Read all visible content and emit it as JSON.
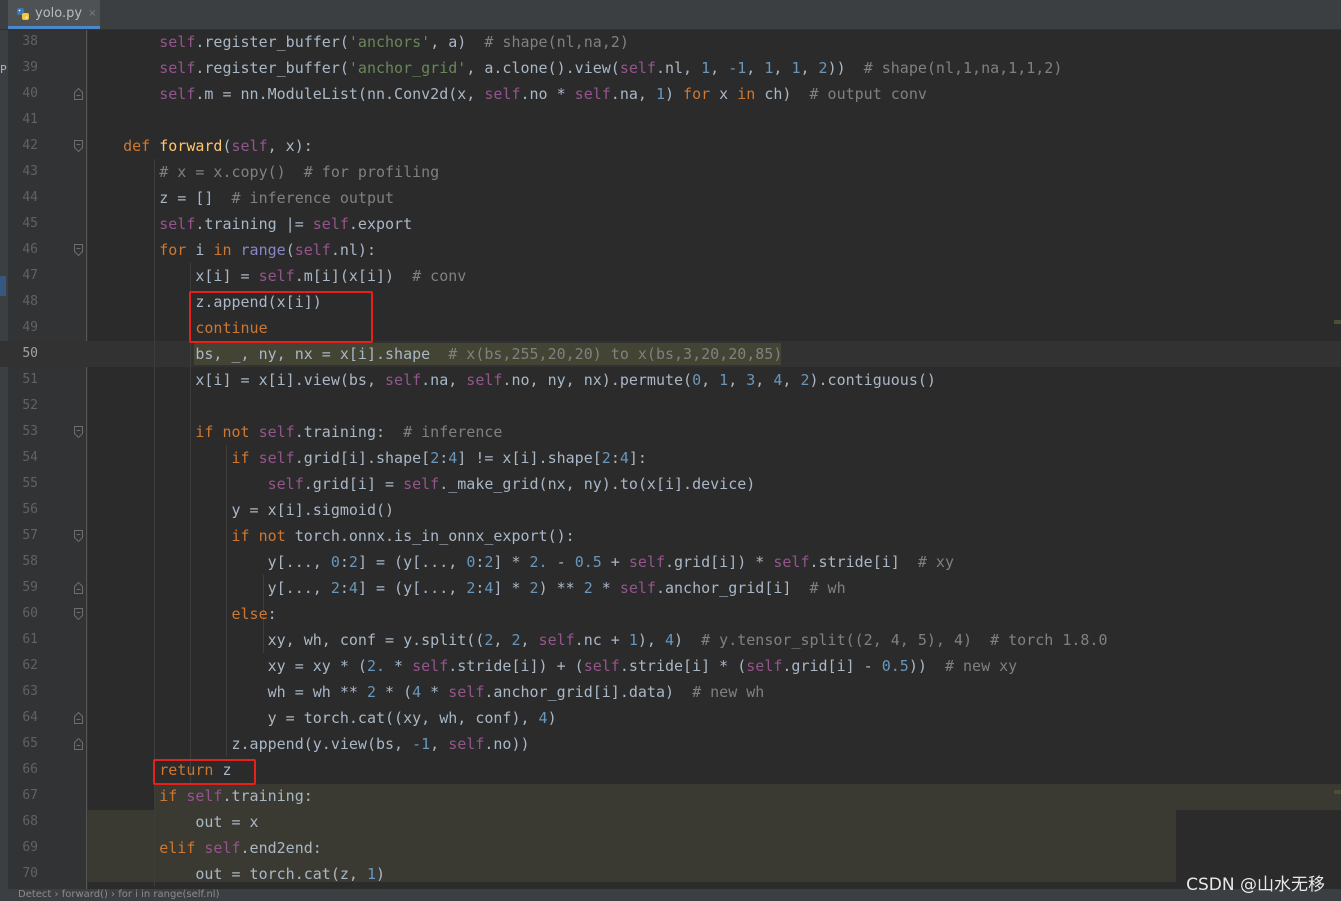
{
  "tab": {
    "file_name": "yolo.py",
    "close": "×"
  },
  "left_strip": {
    "glyph": "P"
  },
  "lines": [
    {
      "n": "38",
      "fold": "",
      "tokens": [
        [
          "pa",
          "        "
        ],
        [
          "sf",
          "self"
        ],
        [
          "pa",
          ".register_buffer("
        ],
        [
          "st",
          "'anchors'"
        ],
        [
          "pa",
          ", a)  "
        ],
        [
          "cm",
          "# shape(nl,na,2)"
        ]
      ]
    },
    {
      "n": "39",
      "fold": "",
      "tokens": [
        [
          "pa",
          "        "
        ],
        [
          "sf",
          "self"
        ],
        [
          "pa",
          ".register_buffer("
        ],
        [
          "st",
          "'anchor_grid'"
        ],
        [
          "pa",
          ", a.clone().view("
        ],
        [
          "sf",
          "self"
        ],
        [
          "pa",
          ".nl, "
        ],
        [
          "nm",
          "1"
        ],
        [
          "pa",
          ", "
        ],
        [
          "nm",
          "-1"
        ],
        [
          "pa",
          ", "
        ],
        [
          "nm",
          "1"
        ],
        [
          "pa",
          ", "
        ],
        [
          "nm",
          "1"
        ],
        [
          "pa",
          ", "
        ],
        [
          "nm",
          "2"
        ],
        [
          "pa",
          "))  "
        ],
        [
          "cm",
          "# shape(nl,1,na,1,1,2)"
        ]
      ]
    },
    {
      "n": "40",
      "fold": "end",
      "tokens": [
        [
          "pa",
          "        "
        ],
        [
          "sf",
          "self"
        ],
        [
          "pa",
          ".m = nn.ModuleList(nn.Conv2d(x, "
        ],
        [
          "sf",
          "self"
        ],
        [
          "pa",
          ".no * "
        ],
        [
          "sf",
          "self"
        ],
        [
          "pa",
          ".na, "
        ],
        [
          "nm",
          "1"
        ],
        [
          "pa",
          ") "
        ],
        [
          "kw",
          "for"
        ],
        [
          "pa",
          " x "
        ],
        [
          "kw",
          "in"
        ],
        [
          "pa",
          " ch)  "
        ],
        [
          "cm",
          "# output conv"
        ]
      ]
    },
    {
      "n": "41",
      "fold": "",
      "tokens": []
    },
    {
      "n": "42",
      "fold": "start",
      "tokens": [
        [
          "pa",
          "    "
        ],
        [
          "kw",
          "def "
        ],
        [
          "fn",
          "forward"
        ],
        [
          "pa",
          "("
        ],
        [
          "sf",
          "self"
        ],
        [
          "pa",
          ", x):"
        ]
      ]
    },
    {
      "n": "43",
      "fold": "",
      "tokens": [
        [
          "pa",
          "        "
        ],
        [
          "cm",
          "# x = x.copy()  # for profiling"
        ]
      ]
    },
    {
      "n": "44",
      "fold": "",
      "tokens": [
        [
          "pa",
          "        z = []  "
        ],
        [
          "cm",
          "# inference output"
        ]
      ]
    },
    {
      "n": "45",
      "fold": "",
      "tokens": [
        [
          "pa",
          "        "
        ],
        [
          "sf",
          "self"
        ],
        [
          "pa",
          ".training |= "
        ],
        [
          "sf",
          "self"
        ],
        [
          "pa",
          ".export"
        ]
      ]
    },
    {
      "n": "46",
      "fold": "start",
      "tokens": [
        [
          "pa",
          "        "
        ],
        [
          "kw",
          "for"
        ],
        [
          "pa",
          " i "
        ],
        [
          "kw",
          "in "
        ],
        [
          "bi",
          "range"
        ],
        [
          "pa",
          "("
        ],
        [
          "sf",
          "self"
        ],
        [
          "pa",
          ".nl):"
        ]
      ]
    },
    {
      "n": "47",
      "fold": "",
      "tokens": [
        [
          "pa",
          "            x[i] = "
        ],
        [
          "sf",
          "self"
        ],
        [
          "pa",
          ".m[i](x[i])  "
        ],
        [
          "cm",
          "# conv"
        ]
      ]
    },
    {
      "n": "48",
      "fold": "",
      "tokens": [
        [
          "pa",
          "            z.append(x[i])"
        ]
      ]
    },
    {
      "n": "49",
      "fold": "",
      "tokens": [
        [
          "pa",
          "            "
        ],
        [
          "kw",
          "continue"
        ]
      ]
    },
    {
      "n": "50",
      "fold": "",
      "cur": true,
      "tokens": [
        [
          "pa",
          "            bs, _, ny, nx = x[i].shape  "
        ],
        [
          "cm",
          "# x(bs,255,20,20) to x(bs,3,20,20,85)"
        ]
      ]
    },
    {
      "n": "51",
      "fold": "",
      "tokens": [
        [
          "pa",
          "            x[i] = x[i].view(bs, "
        ],
        [
          "sf",
          "self"
        ],
        [
          "pa",
          ".na, "
        ],
        [
          "sf",
          "self"
        ],
        [
          "pa",
          ".no, ny, nx).permute("
        ],
        [
          "nm",
          "0"
        ],
        [
          "pa",
          ", "
        ],
        [
          "nm",
          "1"
        ],
        [
          "pa",
          ", "
        ],
        [
          "nm",
          "3"
        ],
        [
          "pa",
          ", "
        ],
        [
          "nm",
          "4"
        ],
        [
          "pa",
          ", "
        ],
        [
          "nm",
          "2"
        ],
        [
          "pa",
          ").contiguous()"
        ]
      ]
    },
    {
      "n": "52",
      "fold": "",
      "tokens": []
    },
    {
      "n": "53",
      "fold": "start",
      "tokens": [
        [
          "pa",
          "            "
        ],
        [
          "kw",
          "if not "
        ],
        [
          "sf",
          "self"
        ],
        [
          "pa",
          ".training:  "
        ],
        [
          "cm",
          "# inference"
        ]
      ]
    },
    {
      "n": "54",
      "fold": "",
      "tokens": [
        [
          "pa",
          "                "
        ],
        [
          "kw",
          "if "
        ],
        [
          "sf",
          "self"
        ],
        [
          "pa",
          ".grid[i].shape["
        ],
        [
          "nm",
          "2"
        ],
        [
          "pa",
          ":"
        ],
        [
          "nm",
          "4"
        ],
        [
          "pa",
          "] != x[i].shape["
        ],
        [
          "nm",
          "2"
        ],
        [
          "pa",
          ":"
        ],
        [
          "nm",
          "4"
        ],
        [
          "pa",
          "]:"
        ]
      ]
    },
    {
      "n": "55",
      "fold": "",
      "tokens": [
        [
          "pa",
          "                    "
        ],
        [
          "sf",
          "self"
        ],
        [
          "pa",
          ".grid[i] = "
        ],
        [
          "sf",
          "self"
        ],
        [
          "pa",
          "._make_grid(nx, ny).to(x[i].device)"
        ]
      ]
    },
    {
      "n": "56",
      "fold": "",
      "tokens": [
        [
          "pa",
          "                y = x[i].sigmoid()"
        ]
      ]
    },
    {
      "n": "57",
      "fold": "start",
      "tokens": [
        [
          "pa",
          "                "
        ],
        [
          "kw",
          "if not "
        ],
        [
          "pa",
          "torch.onnx.is_in_onnx_export():"
        ]
      ]
    },
    {
      "n": "58",
      "fold": "",
      "tokens": [
        [
          "pa",
          "                    y[..., "
        ],
        [
          "nm",
          "0"
        ],
        [
          "pa",
          ":"
        ],
        [
          "nm",
          "2"
        ],
        [
          "pa",
          "] = (y[..., "
        ],
        [
          "nm",
          "0"
        ],
        [
          "pa",
          ":"
        ],
        [
          "nm",
          "2"
        ],
        [
          "pa",
          "] * "
        ],
        [
          "nm",
          "2."
        ],
        [
          "pa",
          " - "
        ],
        [
          "nm",
          "0.5"
        ],
        [
          "pa",
          " + "
        ],
        [
          "sf",
          "self"
        ],
        [
          "pa",
          ".grid[i]) * "
        ],
        [
          "sf",
          "self"
        ],
        [
          "pa",
          ".stride[i]  "
        ],
        [
          "cm",
          "# xy"
        ]
      ]
    },
    {
      "n": "59",
      "fold": "end",
      "tokens": [
        [
          "pa",
          "                    y[..., "
        ],
        [
          "nm",
          "2"
        ],
        [
          "pa",
          ":"
        ],
        [
          "nm",
          "4"
        ],
        [
          "pa",
          "] = (y[..., "
        ],
        [
          "nm",
          "2"
        ],
        [
          "pa",
          ":"
        ],
        [
          "nm",
          "4"
        ],
        [
          "pa",
          "] * "
        ],
        [
          "nm",
          "2"
        ],
        [
          "pa",
          ") ** "
        ],
        [
          "nm",
          "2"
        ],
        [
          "pa",
          " * "
        ],
        [
          "sf",
          "self"
        ],
        [
          "pa",
          ".anchor_grid[i]  "
        ],
        [
          "cm",
          "# wh"
        ]
      ]
    },
    {
      "n": "60",
      "fold": "start",
      "tokens": [
        [
          "pa",
          "                "
        ],
        [
          "kw",
          "else"
        ],
        [
          "pa",
          ":"
        ]
      ]
    },
    {
      "n": "61",
      "fold": "",
      "tokens": [
        [
          "pa",
          "                    xy, wh, conf = y.split(("
        ],
        [
          "nm",
          "2"
        ],
        [
          "pa",
          ", "
        ],
        [
          "nm",
          "2"
        ],
        [
          "pa",
          ", "
        ],
        [
          "sf",
          "self"
        ],
        [
          "pa",
          ".nc + "
        ],
        [
          "nm",
          "1"
        ],
        [
          "pa",
          "), "
        ],
        [
          "nm",
          "4"
        ],
        [
          "pa",
          ")  "
        ],
        [
          "cm",
          "# y.tensor_split((2, 4, 5), 4)  # torch 1.8.0"
        ]
      ]
    },
    {
      "n": "62",
      "fold": "",
      "tokens": [
        [
          "pa",
          "                    xy = xy * ("
        ],
        [
          "nm",
          "2."
        ],
        [
          "pa",
          " * "
        ],
        [
          "sf",
          "self"
        ],
        [
          "pa",
          ".stride[i]) + ("
        ],
        [
          "sf",
          "self"
        ],
        [
          "pa",
          ".stride[i] * ("
        ],
        [
          "sf",
          "self"
        ],
        [
          "pa",
          ".grid[i] - "
        ],
        [
          "nm",
          "0.5"
        ],
        [
          "pa",
          "))  "
        ],
        [
          "cm",
          "# new xy"
        ]
      ]
    },
    {
      "n": "63",
      "fold": "",
      "tokens": [
        [
          "pa",
          "                    wh = wh ** "
        ],
        [
          "nm",
          "2"
        ],
        [
          "pa",
          " * ("
        ],
        [
          "nm",
          "4"
        ],
        [
          "pa",
          " * "
        ],
        [
          "sf",
          "self"
        ],
        [
          "pa",
          ".anchor_grid[i].data)  "
        ],
        [
          "cm",
          "# new wh"
        ]
      ]
    },
    {
      "n": "64",
      "fold": "end",
      "tokens": [
        [
          "pa",
          "                    y = torch.cat((xy, wh, conf), "
        ],
        [
          "nm",
          "4"
        ],
        [
          "pa",
          ")"
        ]
      ]
    },
    {
      "n": "65",
      "fold": "end",
      "tokens": [
        [
          "pa",
          "                z.append(y.view(bs, "
        ],
        [
          "nm",
          "-1"
        ],
        [
          "pa",
          ", "
        ],
        [
          "sf",
          "self"
        ],
        [
          "pa",
          ".no))"
        ]
      ]
    },
    {
      "n": "66",
      "fold": "",
      "tokens": [
        [
          "pa",
          "        "
        ],
        [
          "kw",
          "return"
        ],
        [
          "pa",
          " z"
        ]
      ]
    },
    {
      "n": "67",
      "fold": "",
      "tokens": [
        [
          "pa",
          "        "
        ],
        [
          "kw",
          "if "
        ],
        [
          "sf",
          "self"
        ],
        [
          "pa",
          ".training:"
        ]
      ]
    },
    {
      "n": "68",
      "fold": "",
      "tokens": [
        [
          "pa",
          "            out = x"
        ]
      ]
    },
    {
      "n": "69",
      "fold": "",
      "tokens": [
        [
          "pa",
          "        "
        ],
        [
          "kw",
          "elif "
        ],
        [
          "sf",
          "self"
        ],
        [
          "pa",
          ".end2end:"
        ]
      ]
    },
    {
      "n": "70",
      "fold": "",
      "tokens": [
        [
          "pa",
          "            out = torch.cat(z, "
        ],
        [
          "nm",
          "1"
        ],
        [
          "pa",
          ")"
        ]
      ]
    }
  ],
  "breadcrumb": "Detect  ›  forward()  ›  for i in range(self.nl)",
  "watermark": "CSDN @山水无移",
  "colors": {
    "background": "#2b2b2b",
    "keyword": "#cc7832",
    "self": "#94558d",
    "string": "#6a8759",
    "number": "#6897bb",
    "comment": "#808080",
    "function": "#ffc66d",
    "highlight_box": "#e6201a"
  }
}
